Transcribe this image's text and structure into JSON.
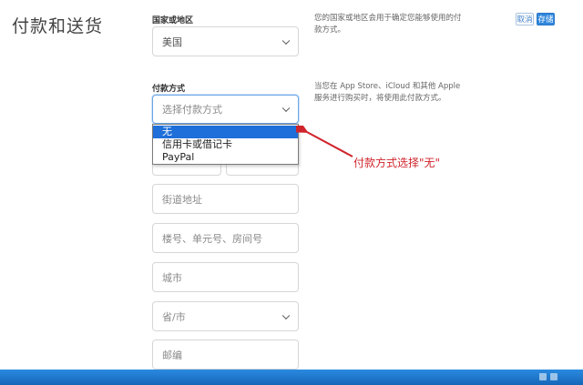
{
  "page": {
    "title": "付款和送货"
  },
  "actions": {
    "cancel_label": "取消",
    "save_label": "存储"
  },
  "country": {
    "label": "国家或地区",
    "value": "美国",
    "hint": "您的国家或地区会用于确定您能够使用的付款方式。"
  },
  "payment": {
    "label": "付款方式",
    "placeholder": "选择付款方式",
    "hint": "当您在 App Store、iCloud 和其他 Apple 服务进行购买时，将使用此付款方式。",
    "options": [
      "无",
      "信用卡或借记卡",
      "PayPal"
    ],
    "selected_index": 0
  },
  "address": {
    "street_placeholder": "街道地址",
    "unit_placeholder": "楼号、单元号、房间号",
    "city_placeholder": "城市",
    "state_placeholder": "省/市",
    "zip_placeholder": "邮编"
  },
  "annotation": {
    "text": "付款方式选择\"无\"",
    "color": "#d0242c"
  },
  "colors": {
    "accent": "#2f86dd",
    "selection": "#1e6fd9"
  }
}
